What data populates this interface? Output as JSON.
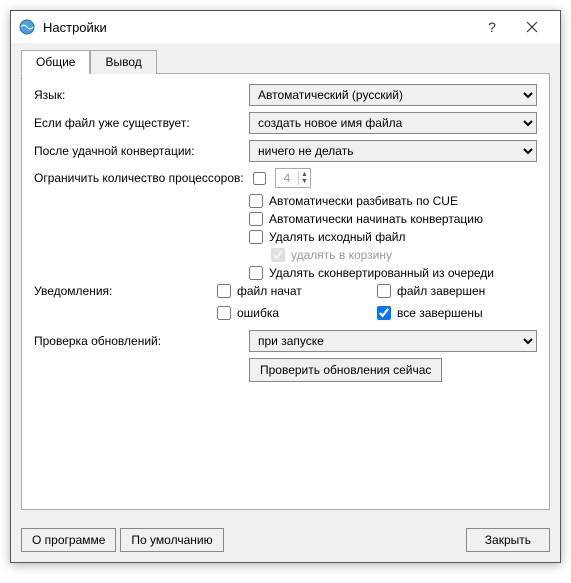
{
  "window": {
    "title": "Настройки"
  },
  "tabs": {
    "general": "Общие",
    "output": "Вывод"
  },
  "labels": {
    "language": "Язык:",
    "if_exists": "Если файл уже существует:",
    "after_convert": "После удачной конвертации:",
    "limit_cpu": "Ограничить количество процессоров:",
    "notifications": "Уведомления:",
    "updates": "Проверка обновлений:"
  },
  "selects": {
    "language": "Автоматический (русский)",
    "if_exists": "создать новое имя файла",
    "after_convert": "ничего не делать",
    "updates": "при запуске"
  },
  "cpu_count": "4",
  "checks": {
    "split_cue": "Автоматически разбивать по CUE",
    "auto_start": "Автоматически начинать конвертацию",
    "delete_src": "Удалять исходный файл",
    "delete_trash": "удалять в корзину",
    "remove_queued": "Удалять сконвертированный из очереди",
    "file_started": "файл начат",
    "file_finished": "файл завершен",
    "error": "ошибка",
    "all_done": "все завершены"
  },
  "buttons": {
    "check_updates": "Проверить обновления сейчас",
    "about": "О программе",
    "defaults": "По умолчанию",
    "close": "Закрыть"
  }
}
